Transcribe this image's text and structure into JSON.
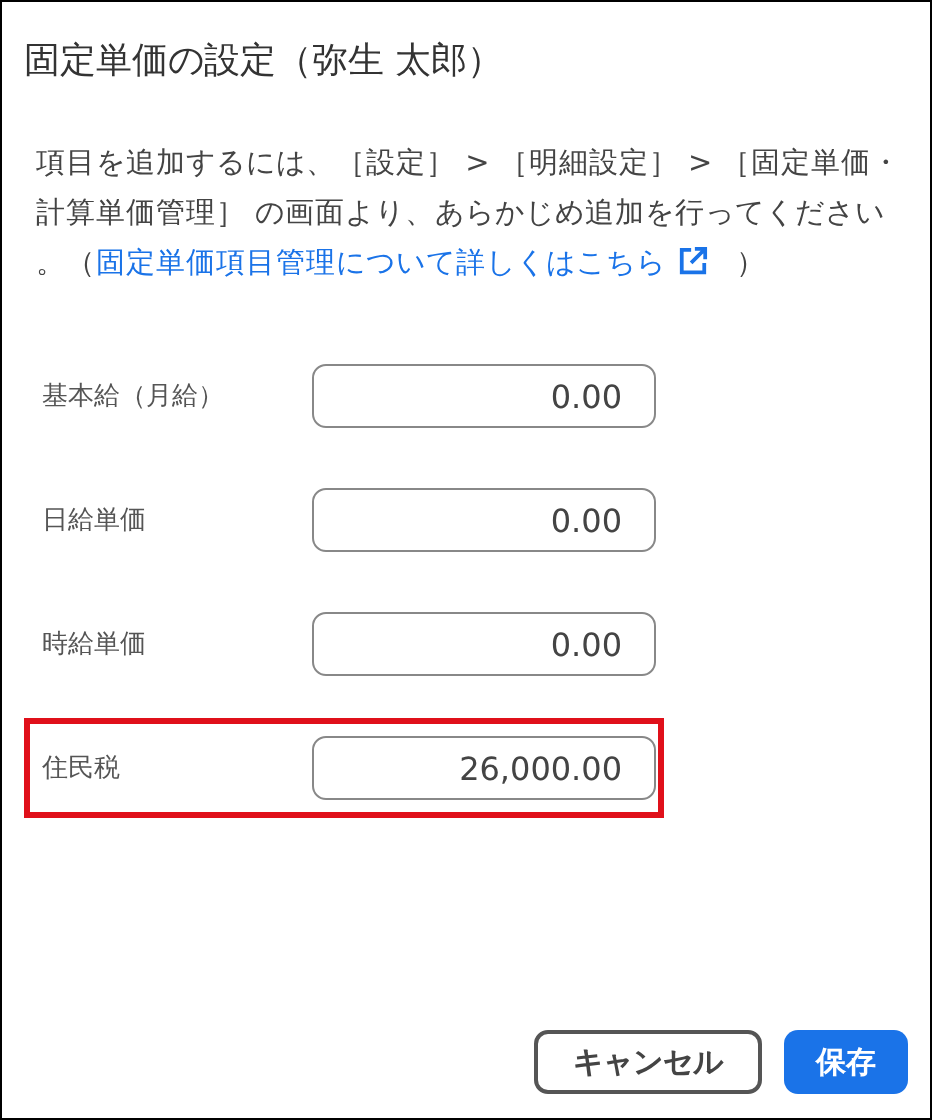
{
  "dialog": {
    "title": "固定単価の設定（弥生 太郎）"
  },
  "description": {
    "text": "項目を追加するには、［設定］ > ［明細設定］ > ［固定単価・計算単価管理］ の画面より、あらかじめ追加を行ってください。（",
    "link": "固定単価項目管理について詳しくはこちら",
    "after": "）"
  },
  "fields": [
    {
      "label": "基本給（月給）",
      "value": "0.00",
      "highlighted": false
    },
    {
      "label": "日給単価",
      "value": "0.00",
      "highlighted": false
    },
    {
      "label": "時給単価",
      "value": "0.00",
      "highlighted": false
    },
    {
      "label": "住民税",
      "value": "26,000.00",
      "highlighted": true
    }
  ],
  "buttons": [
    {
      "label": "キャンセル",
      "kind": "secondary"
    },
    {
      "label": "保存",
      "kind": "primary"
    }
  ]
}
